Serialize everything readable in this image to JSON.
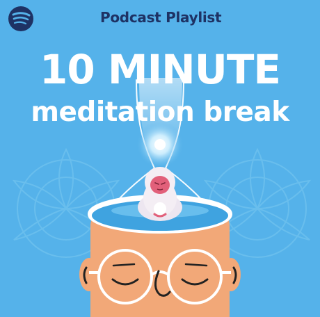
{
  "brand": {
    "icon": "spotify-logo-icon",
    "color": "#1E3264"
  },
  "header": {
    "label": "Podcast Playlist"
  },
  "cover": {
    "title_line1": "10 MINUTE",
    "title_line2": "meditation break",
    "background": "#55B2EA"
  }
}
